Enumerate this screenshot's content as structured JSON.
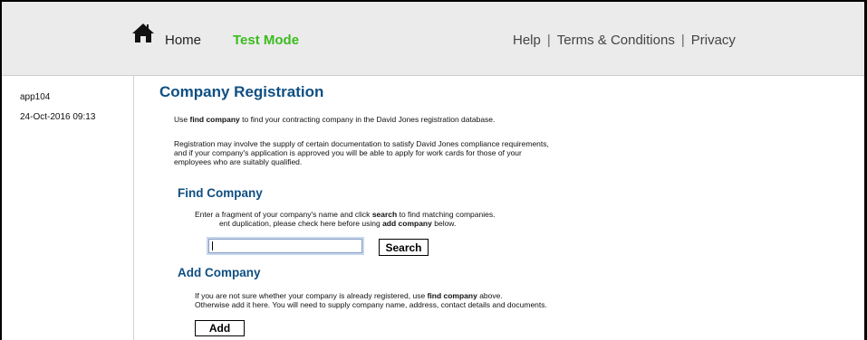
{
  "header": {
    "home_label": "Home",
    "test_mode_label": "Test Mode",
    "help_label": "Help",
    "terms_label": "Terms & Conditions",
    "privacy_label": "Privacy",
    "separator": "|",
    "test_mode_color": "#3dbb1f"
  },
  "sidebar": {
    "app_id": "app104",
    "datetime": "24-Oct-2016 09:13"
  },
  "main": {
    "title": "Company Registration",
    "intro": {
      "use": "Use",
      "find_company": "find company",
      "rest": "to find your contracting company in the David Jones registration database."
    },
    "para2": "Registration may involve the supply of certain documentation to satisfy David Jones compliance requirements, and if your company's application is approved you will be able to apply for work cards for those of your employees who are suitably qualified."
  },
  "find": {
    "title": "Find Company",
    "line1_a": "Enter a fragment of your company's name and click",
    "line1_b": "search",
    "line1_c": "to find matching companies.",
    "line2_a": "ent duplication, please check here before using",
    "line2_b": "add company",
    "line2_c": "below.",
    "search_value": "",
    "search_button": "Search"
  },
  "add": {
    "title": "Add Company",
    "line1_a": "If you are not sure whether your company is already registered, use",
    "line1_b": "find company",
    "line1_c": "above.",
    "line2": "Otherwise add it here. You will need to supply company name, address, contact details and documents.",
    "add_button": "Add"
  }
}
